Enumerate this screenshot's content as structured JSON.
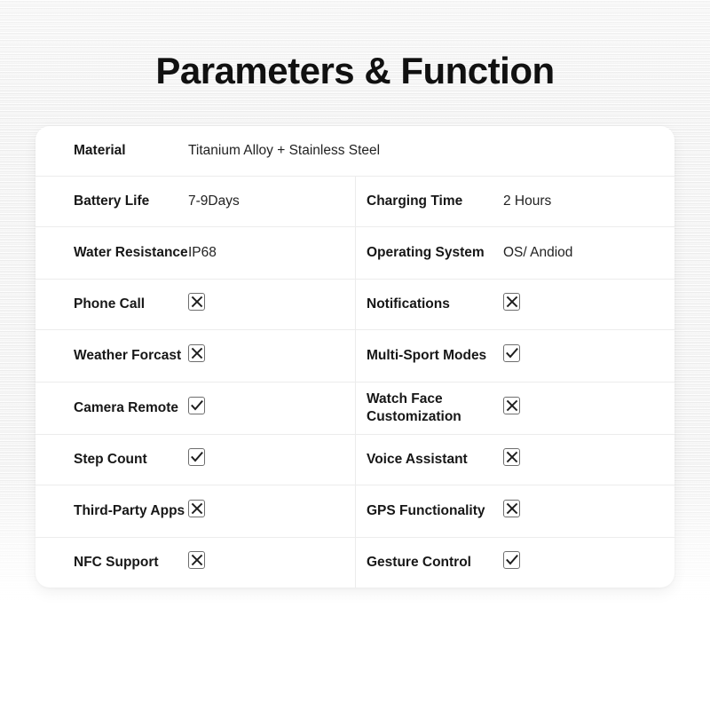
{
  "page": {
    "title": "Parameters & Function",
    "background_color": "#f7f7f7",
    "card_color": "#ffffff",
    "text_color": "#171717",
    "divider_color": "#ececec",
    "mark_border_color": "#6e6e6e",
    "mark_glyph_color": "#1d1d1d"
  },
  "table": {
    "rows": [
      {
        "layout": "full",
        "left": {
          "label": "Material",
          "value": "Titanium Alloy + Stainless Steel",
          "type": "text"
        }
      },
      {
        "layout": "split",
        "left": {
          "label": "Battery Life",
          "value": "7-9Days",
          "type": "text"
        },
        "right": {
          "label": "Charging Time",
          "value": "2 Hours",
          "type": "text"
        }
      },
      {
        "layout": "split",
        "left": {
          "label": "Water Resistance",
          "value": "IP68",
          "type": "text"
        },
        "right": {
          "label": "Operating System",
          "value": "OS/ Andiod",
          "type": "text"
        }
      },
      {
        "layout": "split",
        "left": {
          "label": "Phone Call",
          "value": "x",
          "type": "mark"
        },
        "right": {
          "label": "Notifications",
          "value": "x",
          "type": "mark"
        }
      },
      {
        "layout": "split",
        "left": {
          "label": "Weather Forcast",
          "value": "x",
          "type": "mark"
        },
        "right": {
          "label": "Multi-Sport Modes",
          "value": "check",
          "type": "mark"
        }
      },
      {
        "layout": "split",
        "left": {
          "label": "Camera Remote",
          "value": "check",
          "type": "mark"
        },
        "right": {
          "label": "Watch Face Customization",
          "value": "x",
          "type": "mark"
        }
      },
      {
        "layout": "split",
        "left": {
          "label": "Step Count",
          "value": "check",
          "type": "mark"
        },
        "right": {
          "label": "Voice Assistant",
          "value": "x",
          "type": "mark"
        }
      },
      {
        "layout": "split",
        "left": {
          "label": "Third-Party Apps",
          "value": "x",
          "type": "mark"
        },
        "right": {
          "label": "GPS Functionality",
          "value": "x",
          "type": "mark"
        }
      },
      {
        "layout": "split",
        "left": {
          "label": "NFC Support",
          "value": "x",
          "type": "mark"
        },
        "right": {
          "label": "Gesture Control",
          "value": "check",
          "type": "mark"
        }
      }
    ]
  }
}
